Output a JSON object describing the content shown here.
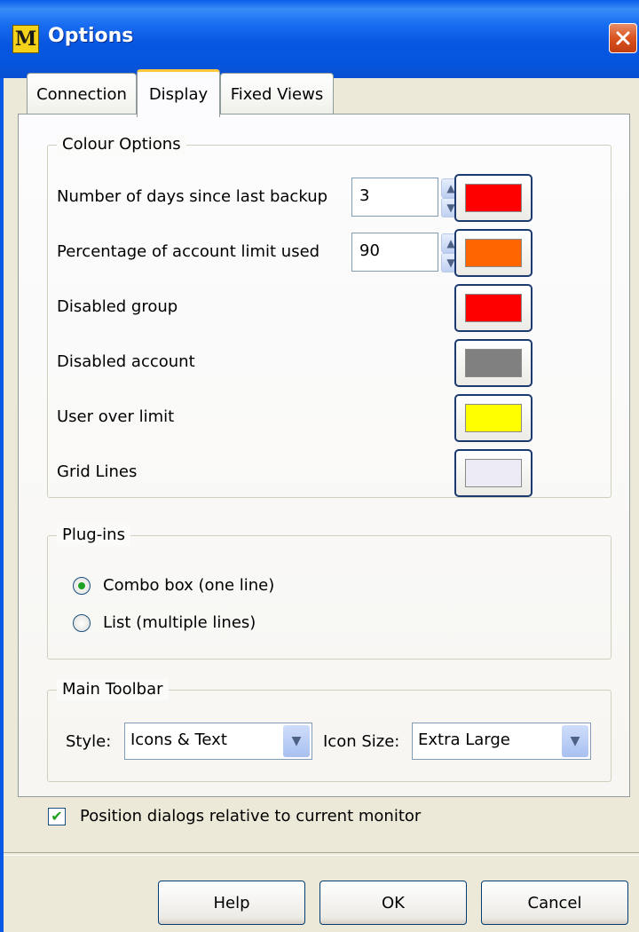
{
  "window": {
    "title": "Options",
    "app_icon_letter": "M"
  },
  "tabs": [
    {
      "label": "Connection",
      "active": false
    },
    {
      "label": "Display",
      "active": true
    },
    {
      "label": "Fixed Views",
      "active": false
    }
  ],
  "colour_options": {
    "legend": "Colour Options",
    "rows": [
      {
        "label": "Number of days since last backup",
        "value": "3",
        "colour": "#ff0000"
      },
      {
        "label": "Percentage of account limit used",
        "value": "90",
        "colour": "#ff6600"
      },
      {
        "label": "Disabled group",
        "colour": "#ff0000"
      },
      {
        "label": "Disabled account",
        "colour": "#808080"
      },
      {
        "label": "User over limit",
        "colour": "#ffff00"
      },
      {
        "label": "Grid Lines",
        "colour": "#ecebf6"
      }
    ]
  },
  "plugins": {
    "legend": "Plug-ins",
    "options": [
      {
        "label": "Combo box (one line)",
        "selected": true
      },
      {
        "label": "List (multiple lines)",
        "selected": false
      }
    ]
  },
  "main_toolbar": {
    "legend": "Main Toolbar",
    "style_label": "Style:",
    "style_value": "Icons & Text",
    "icon_size_label": "Icon Size:",
    "icon_size_value": "Extra Large"
  },
  "position_dialogs": {
    "label": "Position dialogs relative to current monitor",
    "checked": true
  },
  "buttons": {
    "help": "Help",
    "ok": "OK",
    "cancel": "Cancel"
  }
}
